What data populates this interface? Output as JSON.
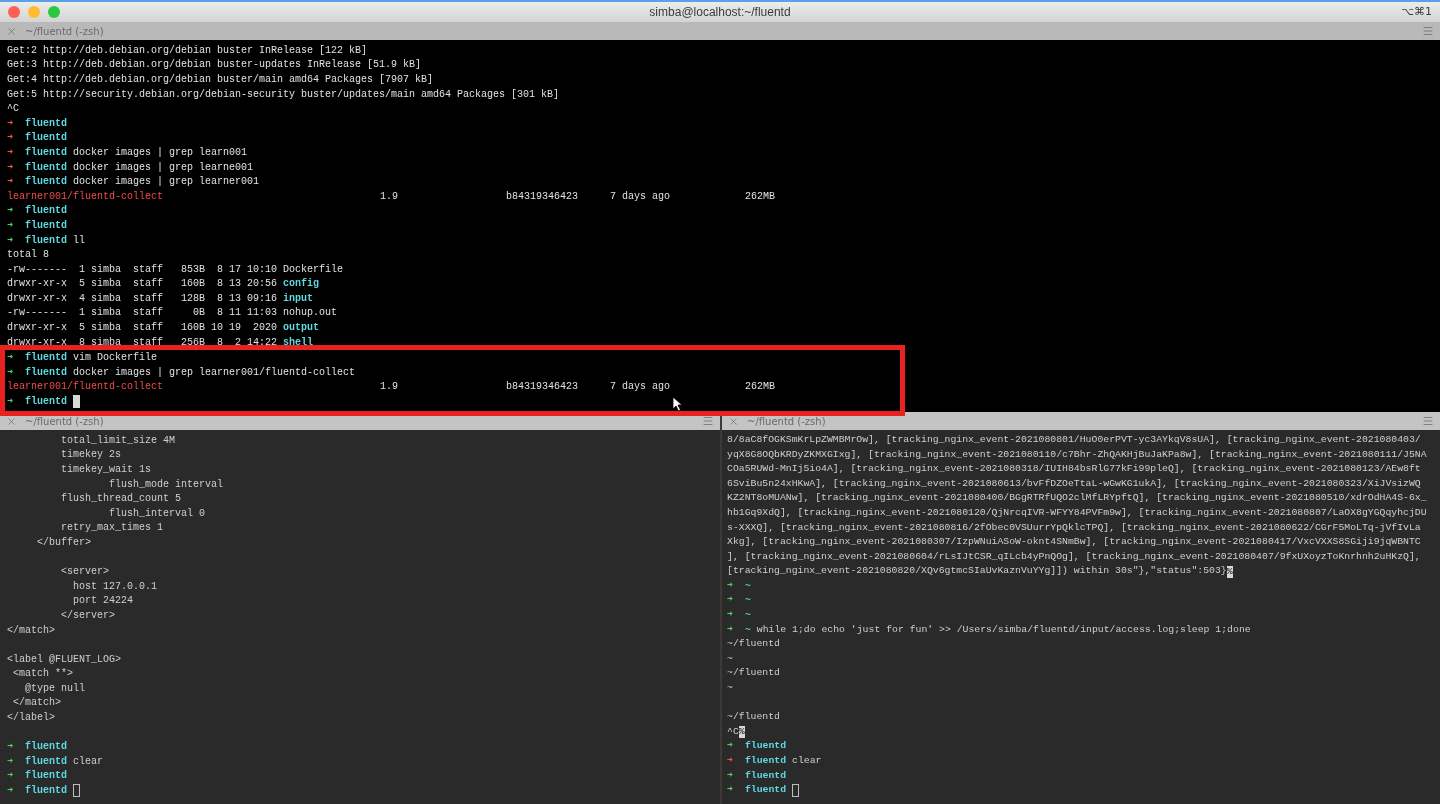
{
  "window": {
    "title": "simba@localhost:~/fluentd",
    "shortcut": "⌥⌘1"
  },
  "tab": {
    "title": "~/fluentd (-zsh)"
  },
  "top_pane": {
    "focused": true,
    "lines": [
      {
        "kind": "text",
        "text": "Get:2 http://deb.debian.org/debian buster InRelease [122 kB]"
      },
      {
        "kind": "text",
        "text": "Get:3 http://deb.debian.org/debian buster-updates InRelease [51.9 kB]"
      },
      {
        "kind": "text",
        "text": "Get:4 http://deb.debian.org/debian buster/main amd64 Packages [7907 kB]"
      },
      {
        "kind": "text",
        "text": "Get:5 http://security.debian.org/debian-security buster/updates/main amd64 Packages [301 kB]"
      },
      {
        "kind": "text",
        "text": "^C"
      },
      {
        "kind": "prompt",
        "arrow": "➜",
        "ok": false,
        "dir": "fluentd"
      },
      {
        "kind": "prompt",
        "arrow": "➜",
        "ok": false,
        "dir": "fluentd"
      },
      {
        "kind": "prompt",
        "arrow": "➜",
        "ok": false,
        "dir": "fluentd",
        "command": "docker images | grep learn001"
      },
      {
        "kind": "prompt",
        "arrow": "➜",
        "ok": false,
        "dir": "fluentd",
        "command": "docker images | grep learne001"
      },
      {
        "kind": "prompt",
        "arrow": "➜",
        "ok": false,
        "dir": "fluentd",
        "command": "docker images | grep learner001"
      },
      {
        "kind": "image",
        "repo": "learner001",
        "path": "/fluentd-collect",
        "tag": "1.9",
        "image_id": "b84319346423",
        "created": "7 days ago",
        "size": "262MB"
      },
      {
        "kind": "prompt",
        "arrow": "➜",
        "ok": true,
        "dir": "fluentd"
      },
      {
        "kind": "prompt",
        "arrow": "➜",
        "ok": true,
        "dir": "fluentd"
      },
      {
        "kind": "prompt",
        "arrow": "➜",
        "ok": true,
        "dir": "fluentd",
        "command": "ll"
      },
      {
        "kind": "text",
        "text": "total 8"
      },
      {
        "kind": "ls",
        "text": "-rw-------  1 simba  staff   853B  8 17 10:10 ",
        "name": "Dockerfile",
        "directory": false
      },
      {
        "kind": "ls",
        "text": "drwxr-xr-x  5 simba  staff   160B  8 13 20:56 ",
        "name": "config",
        "directory": true
      },
      {
        "kind": "ls",
        "text": "drwxr-xr-x  4 simba  staff   128B  8 13 09:16 ",
        "name": "input",
        "directory": true
      },
      {
        "kind": "ls",
        "text": "-rw-------  1 simba  staff     0B  8 11 11:03 ",
        "name": "nohup.out",
        "directory": false
      },
      {
        "kind": "ls",
        "text": "drwxr-xr-x  5 simba  staff   160B 10 19  2020 ",
        "name": "output",
        "directory": true
      },
      {
        "kind": "ls",
        "text": "drwxr-xr-x  8 simba  staff   256B  8  2 14:22 ",
        "name": "shell",
        "directory": true
      }
    ],
    "highlight": {
      "lines": [
        {
          "kind": "prompt",
          "arrow": "➜",
          "ok": true,
          "dir": "fluentd",
          "command": "vim Dockerfile"
        },
        {
          "kind": "prompt",
          "arrow": "➜",
          "ok": true,
          "dir": "fluentd",
          "command": "docker images | grep learner001/fluentd-collect"
        },
        {
          "kind": "image",
          "repo": "learner001",
          "path": "/fluentd-collect",
          "tag": "1.9",
          "image_id": "b84319346423",
          "created": "7 days ago",
          "size": "262MB"
        },
        {
          "kind": "prompt",
          "arrow": "➜",
          "ok": true,
          "dir": "fluentd",
          "cursor": true
        }
      ]
    }
  },
  "bottom_left_pane": {
    "title": "~/fluentd (-zsh)",
    "focused": false,
    "lines": [
      {
        "kind": "text",
        "text": "         total_limit_size 4M"
      },
      {
        "kind": "text",
        "text": "         timekey 2s"
      },
      {
        "kind": "text",
        "text": "         timekey_wait 1s"
      },
      {
        "kind": "text",
        "text": "                 flush_mode interval"
      },
      {
        "kind": "text",
        "text": "         flush_thread_count 5"
      },
      {
        "kind": "text",
        "text": "                 flush_interval 0"
      },
      {
        "kind": "text",
        "text": "         retry_max_times 1"
      },
      {
        "kind": "text",
        "text": "     </buffer>"
      },
      {
        "kind": "blank"
      },
      {
        "kind": "text",
        "text": "         <server>"
      },
      {
        "kind": "text",
        "text": "           host 127.0.0.1"
      },
      {
        "kind": "text",
        "text": "           port 24224"
      },
      {
        "kind": "text",
        "text": "         </server>"
      },
      {
        "kind": "text",
        "text": "</match>"
      },
      {
        "kind": "blank"
      },
      {
        "kind": "text",
        "text": "<label @FLUENT_LOG>"
      },
      {
        "kind": "text",
        "text": " <match **>"
      },
      {
        "kind": "text",
        "text": "   @type null"
      },
      {
        "kind": "text",
        "text": " </match>"
      },
      {
        "kind": "text",
        "text": "</label>"
      },
      {
        "kind": "blank"
      },
      {
        "kind": "prompt",
        "arrow": "➜",
        "ok": true,
        "dir": "fluentd"
      },
      {
        "kind": "prompt",
        "arrow": "➜",
        "ok": true,
        "dir": "fluentd",
        "command": "clear"
      },
      {
        "kind": "prompt",
        "arrow": "➜",
        "ok": true,
        "dir": "fluentd"
      },
      {
        "kind": "prompt",
        "arrow": "➜",
        "ok": true,
        "dir": "fluentd",
        "cursor": true
      }
    ]
  },
  "bottom_right_pane": {
    "title": "~/fluentd (-zsh)",
    "focused": false,
    "lines": [
      {
        "kind": "text",
        "text": "8/8aC8fOGKSmKrLpZWMBMrOw], [tracking_nginx_event-2021080801/HuO0erPVT-yc3AYkqV8sUA], [tracking_nginx_event-2021080403/"
      },
      {
        "kind": "text",
        "text": "yqX8G8OQbKRDyZKMXGIxg], [tracking_nginx_event-2021080110/c7Bhr-ZhQAKHjBuJaKPa8w], [tracking_nginx_event-2021080111/J5NA"
      },
      {
        "kind": "text",
        "text": "COa5RUWd-MnIj5io4A], [tracking_nginx_event-2021080318/IUIH84bsRlG77kFi99pleQ], [tracking_nginx_event-2021080123/AEw8ft"
      },
      {
        "kind": "text",
        "text": "6SviBu5n24xHKwA], [tracking_nginx_event-2021080613/bvFfDZOeTtaL-wGwKG1ukA], [tracking_nginx_event-2021080323/XiJVsizWQ"
      },
      {
        "kind": "text",
        "text": "KZ2NT8oMUANw], [tracking_nginx_event-2021080400/BGgRTRfUQO2clMfLRYpftQ], [tracking_nginx_event-2021080510/xdrOdHA4S-6x_"
      },
      {
        "kind": "text",
        "text": "hb1Gq9XdQ], [tracking_nginx_event-2021080120/QjNrcqIVR-WFYY84PVFm9w], [tracking_nginx_event-2021080807/LaOX8gYGQqyhcjDU"
      },
      {
        "kind": "text",
        "text": "s-XXXQ], [tracking_nginx_event-2021080816/2fObec0VSUurrYpQklcTPQ], [tracking_nginx_event-2021080622/CGrF5MoLTq-jVfIvLa"
      },
      {
        "kind": "text",
        "text": "Xkg], [tracking_nginx_event-2021080307/IzpWNuiASoW-oknt4SNmBw], [tracking_nginx_event-2021080417/VxcVXXS8SGiji9jqWBNTC"
      },
      {
        "kind": "text",
        "text": "], [tracking_nginx_event-2021080604/rLsIJtCSR_qILcb4yPnQOg], [tracking_nginx_event-2021080407/9fxUXoyzToKnrhnh2uHKzQ],"
      },
      {
        "kind": "text",
        "text": "[tracking_nginx_event-2021080820/XQv6gtmcSIaUvKaznVuYYg]]) within 30s\"},\"status\":503}",
        "inverse_tail": "%"
      },
      {
        "kind": "prompt",
        "arrow": "➜",
        "ok": true,
        "dir": "~"
      },
      {
        "kind": "prompt",
        "arrow": "➜",
        "ok": true,
        "dir": "~"
      },
      {
        "kind": "prompt",
        "arrow": "➜",
        "ok": true,
        "dir": "~"
      },
      {
        "kind": "prompt",
        "arrow": "➜",
        "ok": true,
        "dir": "~",
        "command": "while 1;do echo 'just for fun' >> /Users/simba/fluentd/input/access.log;sleep 1;done"
      },
      {
        "kind": "text",
        "text": "~/fluentd"
      },
      {
        "kind": "text",
        "text": "~"
      },
      {
        "kind": "text",
        "text": "~/fluentd"
      },
      {
        "kind": "text",
        "text": "~"
      },
      {
        "kind": "blank"
      },
      {
        "kind": "text",
        "text": "~/fluentd"
      },
      {
        "kind": "text",
        "text": "^C",
        "inverse_tail": "%"
      },
      {
        "kind": "prompt",
        "arrow": "➜",
        "ok": true,
        "dir": "fluentd"
      },
      {
        "kind": "prompt",
        "arrow": "➜",
        "ok": false,
        "dir": "fluentd",
        "command": "clear"
      },
      {
        "kind": "prompt",
        "arrow": "➜",
        "ok": true,
        "dir": "fluentd"
      },
      {
        "kind": "prompt",
        "arrow": "➜",
        "ok": true,
        "dir": "fluentd",
        "cursor": true
      }
    ]
  }
}
